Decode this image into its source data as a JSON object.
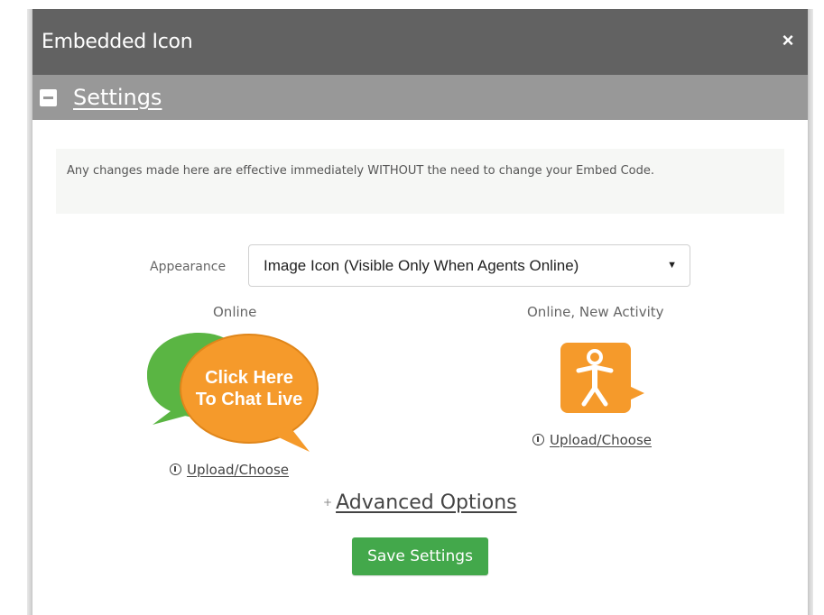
{
  "dialog": {
    "title": "Embedded Icon",
    "close_label": "×"
  },
  "section": {
    "title": "Settings",
    "collapse_icon": "minus-square-icon"
  },
  "notice": {
    "text": "Any changes made here are effective immediately WITHOUT the need to change your Embed Code."
  },
  "appearance": {
    "label": "Appearance",
    "selected": "Image Icon (Visible Only When Agents Online)"
  },
  "online": {
    "label": "Online",
    "icon_line1": "Click Here",
    "icon_line2": "To Chat Live",
    "upload_label": "Upload/Choose"
  },
  "activity": {
    "label": "Online, New Activity",
    "upload_label": "Upload/Choose"
  },
  "advanced": {
    "label": "Advanced Options"
  },
  "save": {
    "label": "Save Settings"
  },
  "colors": {
    "titlebar": "#626262",
    "section_header": "#989898",
    "save_button": "#43a84b",
    "bubble_green": "#5ab543",
    "bubble_orange": "#f59a2b"
  }
}
